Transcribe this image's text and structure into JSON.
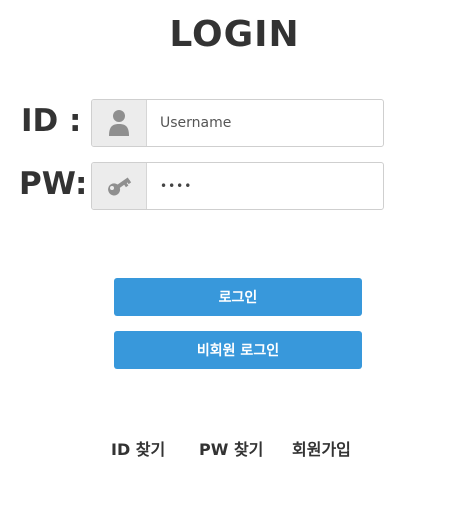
{
  "title": "LOGIN",
  "fields": {
    "id": {
      "label": "ID :",
      "placeholder": "Username",
      "icon": "user-icon"
    },
    "pw": {
      "label": "PW:",
      "value_masked": "••••",
      "icon": "key-icon"
    }
  },
  "buttons": {
    "login": "로그인",
    "guest_login": "비회원 로그인"
  },
  "links": {
    "find_id": "ID 찾기",
    "find_pw": "PW 찾기",
    "signup": "회원가입"
  },
  "colors": {
    "accent": "#3898db",
    "text": "#333333",
    "addon_bg": "#ececec",
    "border": "#cfcfcf"
  }
}
